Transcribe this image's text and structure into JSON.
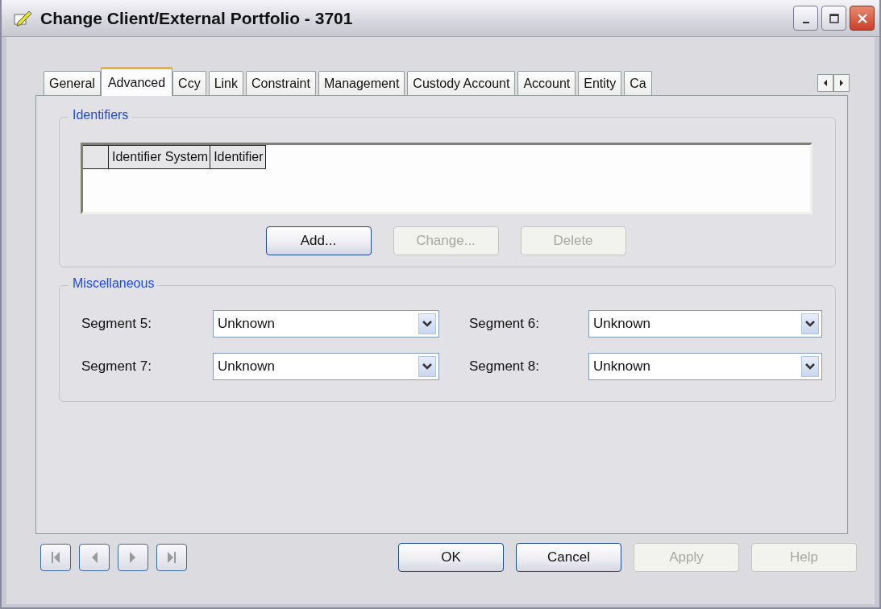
{
  "window": {
    "title": "Change Client/External Portfolio - 3701"
  },
  "tabs": [
    {
      "label": "General",
      "selected": false
    },
    {
      "label": "Advanced",
      "selected": true
    },
    {
      "label": "Ccy",
      "selected": false
    },
    {
      "label": "Link",
      "selected": false
    },
    {
      "label": "Constraint",
      "selected": false
    },
    {
      "label": "Management",
      "selected": false
    },
    {
      "label": "Custody Account",
      "selected": false
    },
    {
      "label": "Account",
      "selected": false
    },
    {
      "label": "Entity",
      "selected": false
    },
    {
      "label": "Ca",
      "selected": false
    }
  ],
  "identifiers": {
    "title": "Identifiers",
    "columns": [
      "Identifier System",
      "Identifier"
    ],
    "buttons": [
      {
        "label": "Add...",
        "disabled": false
      },
      {
        "label": "Change...",
        "disabled": true
      },
      {
        "label": "Delete",
        "disabled": true
      }
    ]
  },
  "miscellaneous": {
    "title": "Miscellaneous",
    "fields": [
      {
        "label": "Segment 5:",
        "value": "Unknown"
      },
      {
        "label": "Segment 6:",
        "value": "Unknown"
      },
      {
        "label": "Segment 7:",
        "value": "Unknown"
      },
      {
        "label": "Segment 8:",
        "value": "Unknown"
      }
    ]
  },
  "buttons": [
    {
      "label": "OK",
      "disabled": false
    },
    {
      "label": "Cancel",
      "disabled": false
    },
    {
      "label": "Apply",
      "disabled": true
    },
    {
      "label": "Help",
      "disabled": true
    }
  ]
}
